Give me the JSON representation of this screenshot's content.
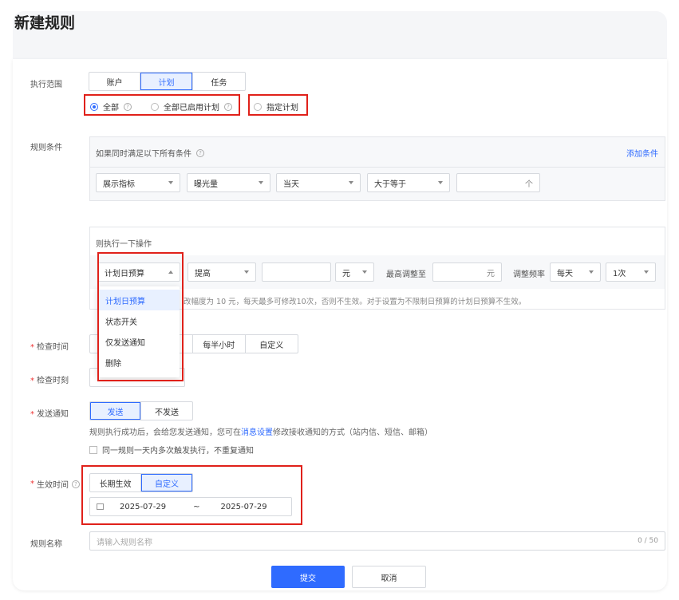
{
  "page": {
    "title": "新建规则"
  },
  "scope": {
    "label": "执行范围",
    "tabs": [
      "账户",
      "计划",
      "任务"
    ],
    "radios": [
      "全部",
      "全部已启用计划",
      "指定计划"
    ]
  },
  "conditions": {
    "label": "规则条件",
    "header": "如果同时满足以下所有条件",
    "add_link": "添加条件",
    "metric_type": "展示指标",
    "metric": "曝光量",
    "period": "当天",
    "operator": "大于等于",
    "unit": "个"
  },
  "actions": {
    "header": "则执行一下操作",
    "target": "计划日预算",
    "direction": "提高",
    "currency": "元",
    "max_label": "最高调整至",
    "max_unit": "元",
    "freq_label": "调整频率",
    "freq_period": "每天",
    "freq_count": "1次",
    "note": "改幅度为 10 元，每天最多可修改10次，否则不生效。对于设置为不限制日预算的计划日预算不生效。",
    "menu": [
      "计划日预算",
      "状态开关",
      "仅发送通知",
      "删除"
    ]
  },
  "check_time": {
    "label": "检查时间",
    "tabs": [
      "每半小时",
      "自定义"
    ]
  },
  "check_moment": {
    "label": "检查时刻"
  },
  "notify": {
    "label": "发送通知",
    "tabs": [
      "发送",
      "不发送"
    ],
    "help_before": "规则执行成功后，会给您发送通知，您可在",
    "help_link": "消息设置",
    "help_after": "修改接收通知的方式（站内信、短信、邮箱）",
    "checkbox": "同一规则一天内多次触发执行，不重复通知"
  },
  "effective": {
    "label": "生效时间",
    "tabs": [
      "长期生效",
      "自定义"
    ],
    "start": "2025-07-29",
    "sep": "~",
    "end": "2025-07-29"
  },
  "rule_name": {
    "label": "规则名称",
    "placeholder": "请输入规则名称",
    "counter": "0 / 50"
  },
  "footer": {
    "submit": "提交",
    "cancel": "取消"
  }
}
